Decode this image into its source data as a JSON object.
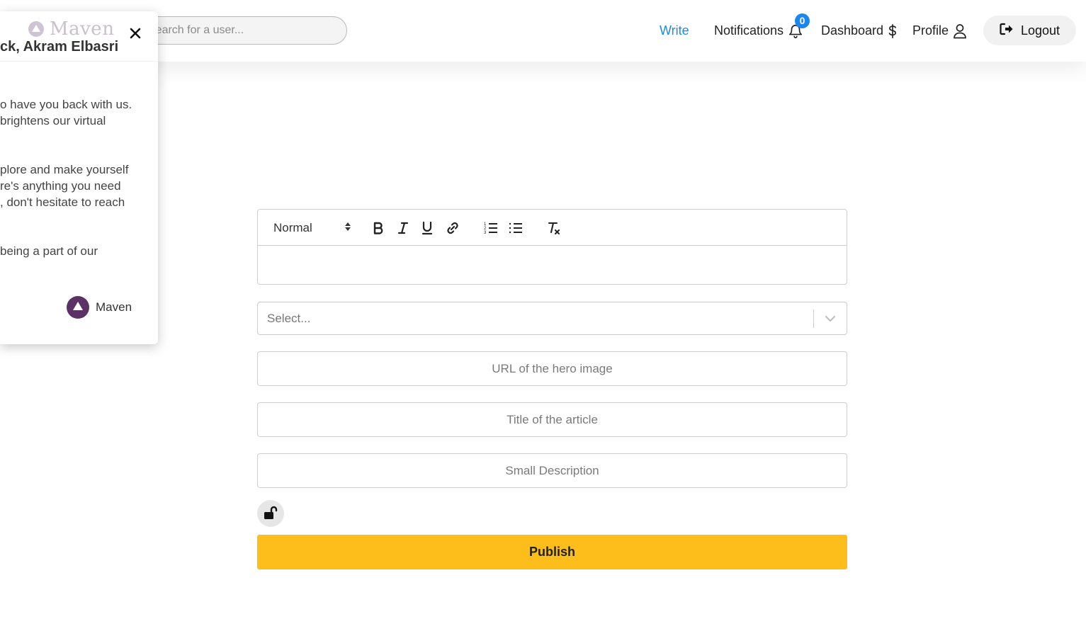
{
  "header": {
    "search": {
      "placeholder": "Search for a user..."
    },
    "nav": {
      "write": "Write",
      "notifications": "Notifications",
      "notifications_count": "0",
      "dashboard": "Dashboard",
      "profile": "Profile",
      "logout": "Logout"
    },
    "colors": {
      "accent": "#1e88e5",
      "badge": "#1a86f0"
    }
  },
  "welcome_popup": {
    "brand": "Maven",
    "title": "ck, Akram Elbasri",
    "paragraphs": [
      [
        "o have you back with us.",
        "brightens our virtual"
      ],
      [
        "plore and make yourself",
        "re's anything you need",
        ", don't hesitate to reach"
      ],
      [
        "being a part of our"
      ]
    ],
    "signature": "Maven",
    "icons": {
      "close": "close-icon",
      "brand": "maven-logo"
    }
  },
  "editor": {
    "heading_format": "Normal",
    "toolbar_icons": [
      "bold-icon",
      "italic-icon",
      "underline-icon",
      "link-icon",
      "ordered-list-icon",
      "bullet-list-icon",
      "clear-format-icon"
    ]
  },
  "form": {
    "category_select": {
      "placeholder": "Select..."
    },
    "hero_image": {
      "placeholder": "URL of the hero image"
    },
    "title": {
      "placeholder": "Title of the article"
    },
    "description": {
      "placeholder": "Small Description"
    },
    "visibility_icon": "unlock-icon",
    "publish_label": "Publish",
    "colors": {
      "publish": "#fdbd1a"
    }
  }
}
